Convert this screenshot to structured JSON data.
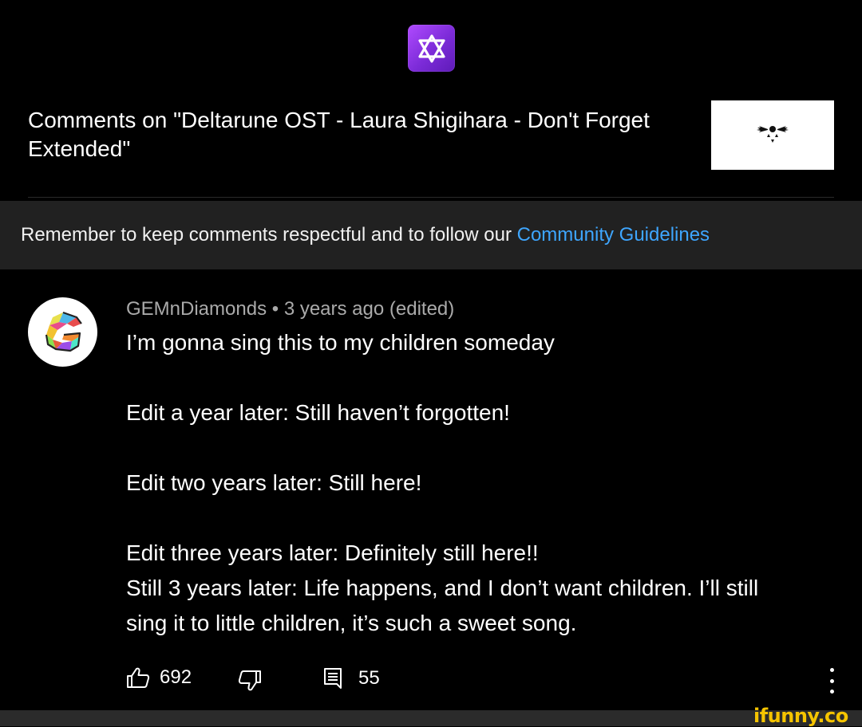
{
  "header": {
    "app_icon": "star-of-david-icon",
    "title": "Comments on \"Deltarune OST - Laura Shigihara - Don't Forget Extended\"",
    "thumbnail_icon": "delta-rune-emblem-icon"
  },
  "notice": {
    "text": "Remember to keep comments respectful and to follow our ",
    "link": "Community Guidelines",
    "link_color": "#3ea6ff"
  },
  "comment": {
    "author": "GEMnDiamonds",
    "separator": "•",
    "time": "3 years ago (edited)",
    "avatar_icon": "gemndiamonds-logo",
    "lines": [
      "I’m gonna sing this to my children someday",
      "Edit a year later: Still haven’t forgotten!",
      "Edit two years later: Still here!",
      "Edit three years later: Definitely still here!!",
      "Still 3 years later: Life happens, and I don’t want children. I’ll still",
      "sing it to little children, it’s such a sweet song."
    ],
    "likes": "692",
    "replies": "55"
  },
  "actions": {
    "like_icon": "thumbs-up-icon",
    "dislike_icon": "thumbs-down-icon",
    "reply_icon": "reply-icon",
    "more_icon": "more-vertical-icon"
  },
  "watermark": "ifunny.co"
}
